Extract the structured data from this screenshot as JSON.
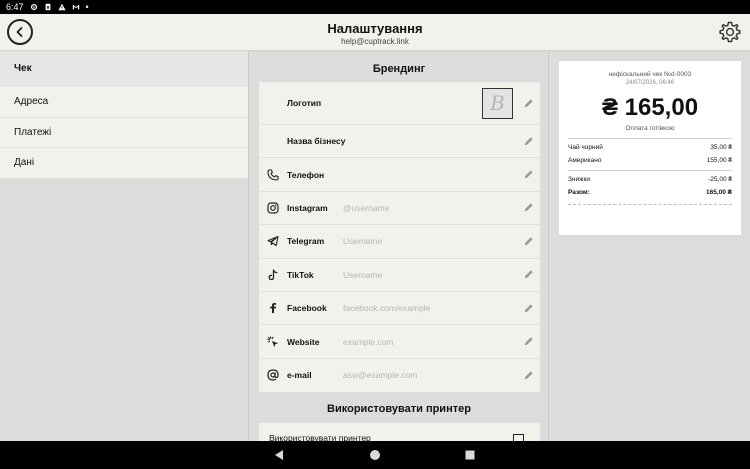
{
  "statusbar": {
    "time": "6:47",
    "dot": "•"
  },
  "header": {
    "title": "Налаштування",
    "email": "help@cuptrack.link"
  },
  "sidebar": {
    "items": [
      {
        "label": "Чек",
        "active": true
      },
      {
        "label": "Адреса"
      },
      {
        "label": "Платежі"
      },
      {
        "label": "Дані"
      }
    ]
  },
  "branding": {
    "title": "Брендинг",
    "logo_label": "Логотип",
    "logo_letter": "B",
    "business_name_label": "Назва бізнесу",
    "rows": [
      {
        "label": "Телефон",
        "value": "",
        "icon": "phone-icon"
      },
      {
        "label": "Instagram",
        "value": "@username",
        "icon": "instagram-icon"
      },
      {
        "label": "Telegram",
        "value": "Username",
        "icon": "telegram-icon"
      },
      {
        "label": "TikTok",
        "value": "Username",
        "icon": "tiktok-icon"
      },
      {
        "label": "Facebook",
        "value": "facebook.com/example",
        "icon": "facebook-icon"
      },
      {
        "label": "Website",
        "value": "example.com",
        "icon": "cursor-click-icon"
      },
      {
        "label": "e-mail",
        "value": "asw@example.com",
        "icon": "at-sign-icon"
      }
    ]
  },
  "printer": {
    "title": "Використовувати принтер",
    "row_label": "Використовувати принтер",
    "checked": false
  },
  "receipt": {
    "header": "нефіскальний чек №d-0003",
    "date": "24/07/2026, 06:46",
    "total": "₴ 165,00",
    "payment": "Оплата готівкою",
    "items": [
      {
        "name": "Чай чорний",
        "price": "35,00 ₴"
      },
      {
        "name": "Американо",
        "price": "155,00 ₴"
      }
    ],
    "discount_label": "Знижки",
    "discount_value": "-25,00 ₴",
    "sum_label": "Разом:",
    "sum_value": "165,00 ₴"
  }
}
